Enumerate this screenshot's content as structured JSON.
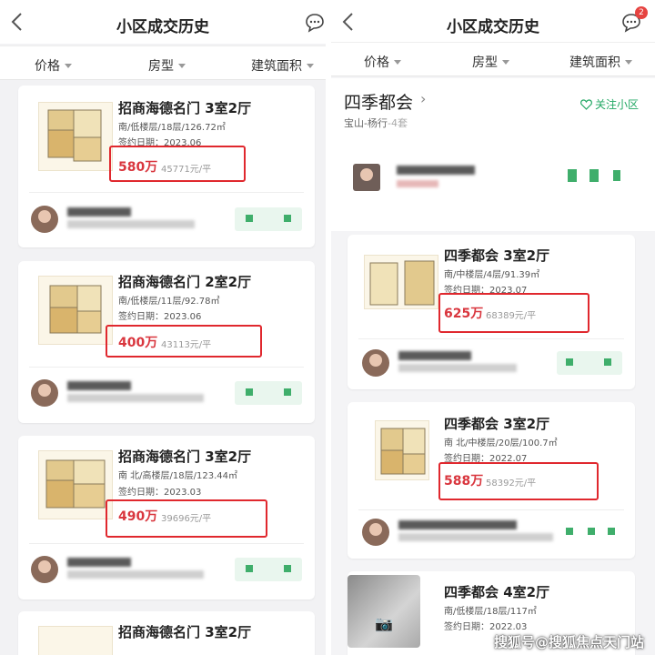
{
  "left": {
    "title": "小区成交历史",
    "filters": [
      "价格",
      "房型",
      "建筑面积"
    ],
    "listings": [
      {
        "name": "招商海德名门 3室2厅",
        "meta": "南/低楼层/18层/126.72㎡",
        "date": "签约日期：2023.06",
        "price": "580万",
        "unit_price": "45771元/平"
      },
      {
        "name": "招商海德名门 2室2厅",
        "meta": "南/低楼层/11层/92.78㎡",
        "date": "签约日期：2023.06",
        "price": "400万",
        "unit_price": "43113元/平"
      },
      {
        "name": "招商海德名门 3室2厅",
        "meta": "南 北/高楼层/18层/123.44㎡",
        "date": "签约日期：2023.03",
        "price": "490万",
        "unit_price": "39696元/平"
      },
      {
        "name": "招商海德名门 3室2厅"
      }
    ]
  },
  "right": {
    "title": "小区成交历史",
    "badge": "2",
    "filters": [
      "价格",
      "房型",
      "建筑面积"
    ],
    "community": {
      "name": "四季都会",
      "chevron": "›",
      "district": "宝山-杨行",
      "count": "-4套",
      "follow": "关注小区"
    },
    "listings": [
      {
        "name": "四季都会 3室2厅",
        "meta": "南/中楼层/4层/91.39㎡",
        "date": "签约日期：2023.07",
        "price": "625万",
        "unit_price": "68389元/平"
      },
      {
        "name": "四季都会 3室2厅",
        "meta": "南 北/中楼层/20层/100.7㎡",
        "date": "签约日期：2022.07",
        "price": "588万",
        "unit_price": "58392元/平"
      },
      {
        "name": "四季都会 4室2厅",
        "meta": "南/低楼层/18层/117㎡",
        "date": "签约日期：2022.03"
      }
    ]
  },
  "watermark": "搜狐号@搜狐焦点天门站",
  "icons": {
    "back": "chevron-left-icon",
    "chat": "chat-bubble-icon",
    "follow": "heart-outline-icon",
    "camera": "camera-icon"
  },
  "colors": {
    "price": "#d9363e",
    "highlight": "#e0282e",
    "accent": "#22a864"
  }
}
